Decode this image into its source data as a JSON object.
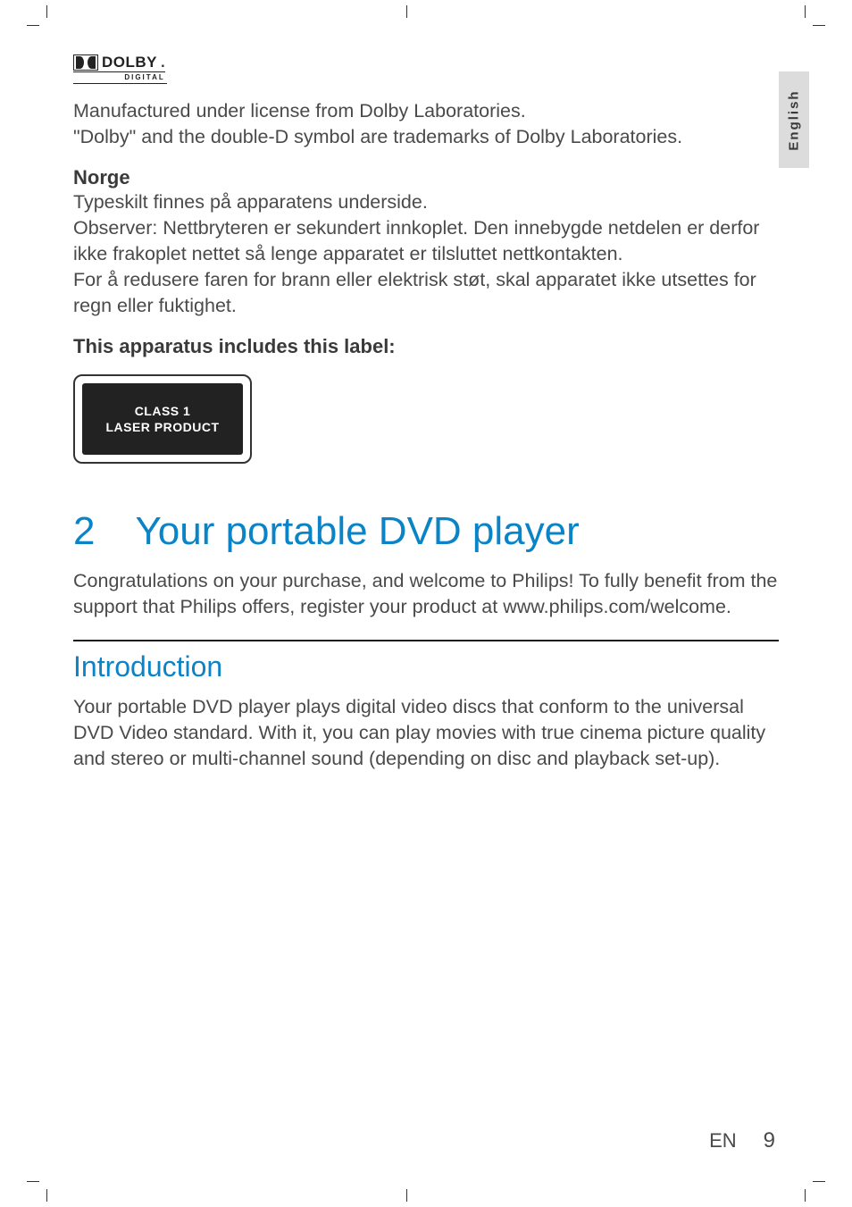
{
  "langTab": "English",
  "dolby": {
    "brand": "DOLBY",
    "sub": "DIGITAL",
    "license": "Manufactured under license from Dolby Laboratories.\n\"Dolby\" and the double-D symbol are trademarks of Dolby Laboratories."
  },
  "norge": {
    "head": "Norge",
    "body": "Typeskilt finnes på apparatens underside.\nObserver: Nettbryteren er sekundert innkoplet. Den innebygde netdelen er derfor ikke frakoplet nettet så lenge apparatet er tilsluttet nettkontakten.\nFor å redusere faren for brann eller elektrisk støt, skal apparatet ikke utsettes for regn eller fuktighet."
  },
  "labelIntro": "This apparatus includes this label:",
  "laser": {
    "line1": "CLASS 1",
    "line2": "LASER PRODUCT"
  },
  "chapter": {
    "num": "2",
    "title": "Your portable DVD player",
    "body": "Congratulations on your purchase, and welcome to Philips! To fully benefit from the support that Philips offers, register your product at www.philips.com/welcome."
  },
  "intro": {
    "head": "Introduction",
    "body": "Your portable DVD player plays digital video discs that conform to the universal DVD Video standard. With it, you can play movies with true cinema picture quality and stereo or multi-channel sound (depending on disc and playback set-up)."
  },
  "footer": {
    "lang": "EN",
    "page": "9"
  }
}
